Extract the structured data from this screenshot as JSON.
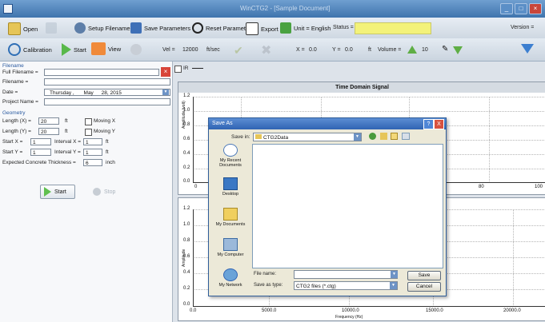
{
  "window": {
    "title": "WinCTG2 - [Sample Document]"
  },
  "toolbar1": {
    "open": "Open",
    "setup_filename": "Setup Filename",
    "save_parameters": "Save Parameters",
    "reset_parameter": "Reset Parameter",
    "export": "Export",
    "unit": "Unit = English",
    "status_label": "Status =",
    "version_label": "Version ="
  },
  "toolbar2": {
    "calibration": "Calibration",
    "start": "Start",
    "view": "View",
    "vel_label": "Vel =",
    "vel_value": "12000",
    "vel_unit": "ft/sec",
    "x_label": "X =",
    "x_value": "0.0",
    "y_label": "Y =",
    "y_value": "0.0",
    "y_unit": "ft",
    "volume_label": "Volume =",
    "volume_value": "10"
  },
  "left": {
    "filename_section": "Filename",
    "full_filename_label": "Full Filename =",
    "filename_label": "Filename =",
    "date_label": "Date =",
    "date_day": "Thursday ,",
    "date_month": "May",
    "date_rest": "28, 2015",
    "project_label": "Project Name =",
    "geometry_section": "Geometry",
    "length_x_label": "Length (X) =",
    "length_x_value": "20",
    "length_y_label": "Length (Y) =",
    "length_y_value": "20",
    "unit_ft": "ft",
    "moving_x": "Moving X",
    "moving_y": "Moving Y",
    "start_x_label": "Start X =",
    "start_x_value": "1",
    "interval_x_label": "Interval X =",
    "interval_x_value": "1",
    "start_y_label": "Start Y =",
    "start_y_value": "1",
    "interval_y_label": "Interval Y =",
    "interval_y_value": "1",
    "thickness_label": "Expected Concrete Thickness =",
    "thickness_value": "6",
    "thickness_unit": "inch",
    "start_button": "Start",
    "stop_button": "Stop"
  },
  "plot": {
    "tab_label": "IR",
    "top_title": "Time Domain Signal",
    "top_y_label": "Amplitude (volt)",
    "top_y_ticks": [
      "1.2",
      "1.0",
      "0.8",
      "0.6",
      "0.4",
      "0.2",
      "0.0"
    ],
    "top_x_ticks": [
      "0",
      "80",
      "100"
    ],
    "bottom_y_label": "Amplitude",
    "bottom_y_ticks": [
      "1.2",
      "1.0",
      "0.8",
      "0.6",
      "0.4",
      "0.2",
      "0.0"
    ],
    "bottom_x_ticks": [
      "0.0",
      "5000.0",
      "10000.0",
      "15000.0",
      "20000.0"
    ],
    "bottom_x_label": "Frequency (Hz)"
  },
  "dialog": {
    "title": "Save As",
    "save_in_label": "Save in:",
    "save_in_value": "CTG2Data",
    "places": [
      "My Recent Documents",
      "Desktop",
      "My Documents",
      "My Computer",
      "My Network"
    ],
    "file_name_label": "File name:",
    "file_name_value": "",
    "save_as_type_label": "Save as type:",
    "save_as_type_value": "CTG2 files (*.ctg)",
    "save_button": "Save",
    "cancel_button": "Cancel",
    "help_glyph": "?",
    "close_glyph": "X"
  },
  "colors": {
    "titlebar": "#3f74ad",
    "status": "#f3f27a",
    "dialog_title": "#2f63b3"
  }
}
